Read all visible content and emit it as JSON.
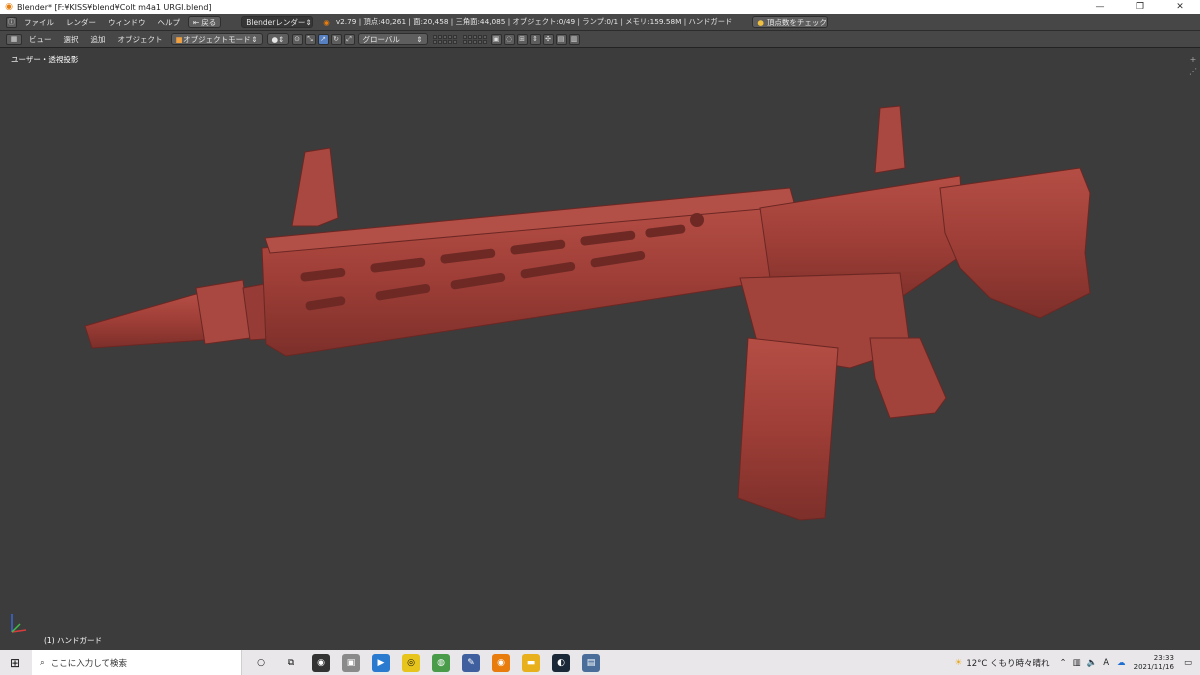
{
  "window": {
    "title": "Blender* [F:¥KISS¥blend¥Colt m4a1 URGI.blend]",
    "minimize": "—",
    "restore": "❐",
    "close": "✕"
  },
  "menubar": {
    "file": "ファイル",
    "render": "レンダー",
    "window": "ウィンドウ",
    "help": "ヘルプ",
    "back_label": "戻る",
    "engine": "Blenderレンダー",
    "stats": "v2.79 | 頂点:40,261 | 面:20,458 | 三角面:44,085 | オブジェクト:0/49 | ランプ:0/1 | メモリ:159.58M | ハンドガード",
    "check_vertices": "頂点数をチェック"
  },
  "toolbar": {
    "view": "ビュー",
    "select": "選択",
    "add": "追加",
    "object": "オブジェクト",
    "mode": "オブジェクトモード",
    "orientation": "グローバル"
  },
  "viewport": {
    "view_label": "ユーザー・透視投影",
    "object_label": "(1) ハンドガード",
    "model_color": "#9f3f38",
    "background": "#3c3c3c"
  },
  "taskbar": {
    "search_placeholder": "ここに入力して検索",
    "weather": "12°C くもり時々晴れ",
    "time": "23:33",
    "date": "2021/11/16",
    "ime": "A"
  }
}
